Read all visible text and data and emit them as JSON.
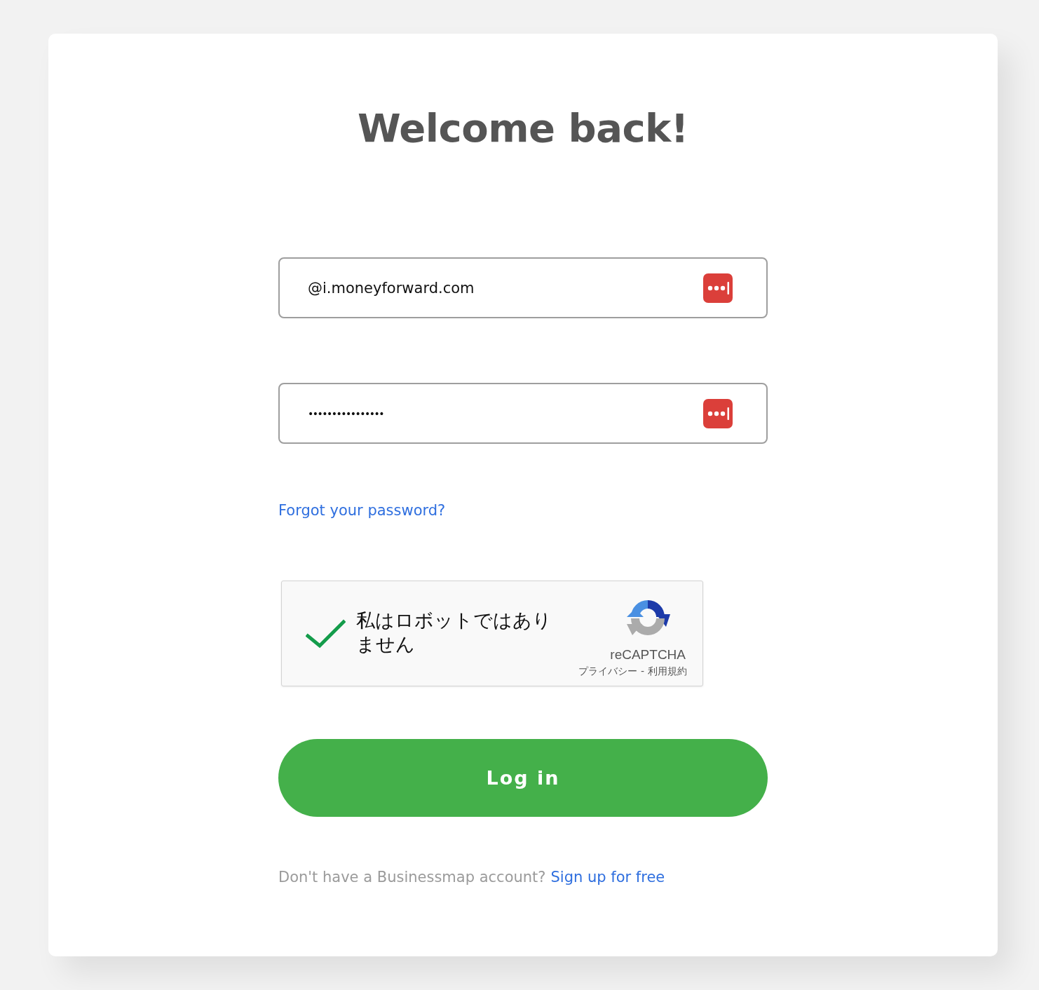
{
  "heading": "Welcome back!",
  "fields": [
    {
      "kind": "email",
      "value": "@i.moneyforward.com"
    },
    {
      "kind": "password",
      "value": "••••••••••••••••"
    }
  ],
  "forgot_link": "Forgot your password?",
  "recaptcha": {
    "checked": true,
    "label": "私はロボットではありません",
    "brand": "reCAPTCHA",
    "privacy_link": "プライバシー",
    "separator": "-",
    "terms_link": "利用規約"
  },
  "login_button": {
    "label": "Log in"
  },
  "signup": {
    "prompt": "Don't have a Businessmap account?",
    "link": "Sign up for free"
  }
}
